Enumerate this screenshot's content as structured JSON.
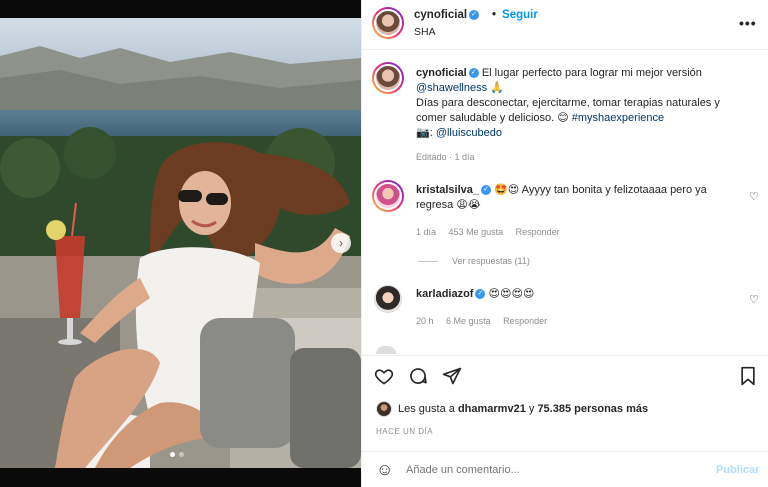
{
  "post": {
    "author": "cynoficial",
    "follow_label": "Seguir",
    "location": "SHA",
    "more_label": "•••"
  },
  "caption": {
    "author": "cynoficial",
    "line1": "El lugar perfecto para lograr mi mejor versión",
    "mention": "@shawellness",
    "pray": "🙏",
    "line2": "Días para desconectar, ejercitarme, tomar terapias naturales y",
    "line3": "comer saludable y delicioso.",
    "smile": "😊",
    "hashtag": "#myshaexperience",
    "camera": "📷: ",
    "credit": "@lluiscubedo",
    "edited": "Editado · 1 día"
  },
  "comments": [
    {
      "author": "kristalsilva_",
      "text": "🤩😍 Ayyyy tan bonita y felizotaaaa pero ya",
      "text2": "regresa 😩😭",
      "age": "1 día",
      "likes": "453 Me gusta",
      "reply": "Responder",
      "replies": "Ver respuestas (11)"
    },
    {
      "author": "karladiazof",
      "text": "😍😍😍😍",
      "age": "20 h",
      "likes": "6 Me gusta",
      "reply": "Responder"
    }
  ],
  "likes": {
    "prefix": "Les gusta a",
    "user": "dhamarmv21",
    "joiner": "y",
    "count": "75.385 personas más"
  },
  "timestamp": "HACE UN DÍA",
  "comment_box": {
    "placeholder": "Añade un comentario...",
    "publish": "Publicar"
  },
  "icons": {
    "heart": "heart-icon",
    "comment": "comment-icon",
    "share": "share-icon",
    "save": "bookmark-icon"
  },
  "colors": {
    "link": "#0095f6",
    "verified": "#3897f0",
    "tag": "#00376b"
  }
}
